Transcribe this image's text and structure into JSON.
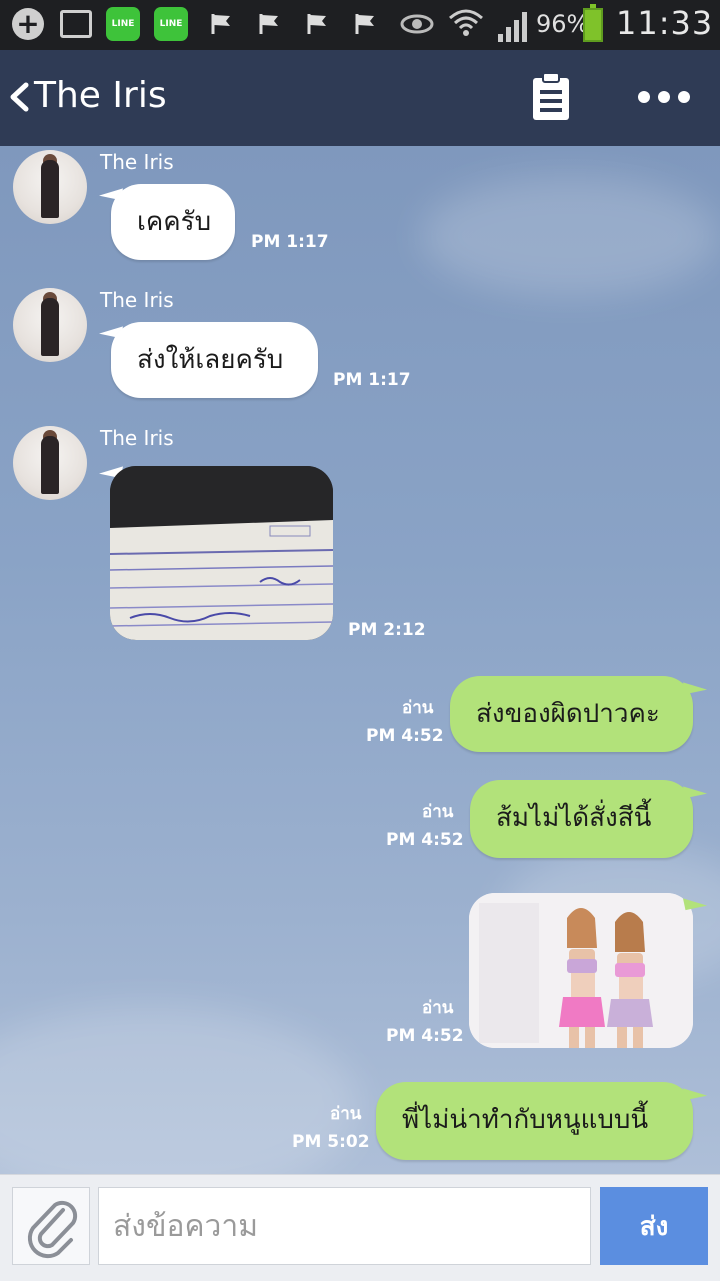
{
  "status_bar": {
    "battery_percent": "96%",
    "time": "11:33",
    "line_badge": "LINE",
    "icons": [
      "add-icon",
      "image-icon",
      "line-app-icon",
      "line-app-icon",
      "flag-icon",
      "flag-icon",
      "flag-icon",
      "flag-icon",
      "eye-icon",
      "wifi-icon",
      "signal-icon",
      "battery-icon"
    ]
  },
  "header": {
    "title": "The Iris"
  },
  "messages": [
    {
      "direction": "in",
      "sender": "The Iris",
      "text": "เคครับ",
      "time": "PM 1:17"
    },
    {
      "direction": "in",
      "sender": "The Iris",
      "text": "ส่งให้เลยครับ",
      "time": "PM 1:17"
    },
    {
      "direction": "in",
      "sender": "The Iris",
      "type": "photo",
      "photo_desc": "receipt",
      "time": "PM 2:12"
    },
    {
      "direction": "out",
      "read": "อ่าน",
      "text": "ส่งของผิดปาวคะ",
      "time": "PM 4:52"
    },
    {
      "direction": "out",
      "read": "อ่าน",
      "text": "ส้มไม่ได้สั่งสีนี้",
      "time": "PM 4:52"
    },
    {
      "direction": "out",
      "read": "อ่าน",
      "type": "photo",
      "photo_desc": "swimwear",
      "time": "PM 4:52"
    },
    {
      "direction": "out",
      "read": "อ่าน",
      "text": "พี่ไม่น่าทำกับหนูแบบนี้",
      "time": "PM 5:02"
    }
  ],
  "input_bar": {
    "placeholder": "ส่งข้อความ",
    "send_label": "ส่ง"
  },
  "colors": {
    "header_bg": "#2f3b55",
    "incoming_bubble": "#ffffff",
    "outgoing_bubble": "#b2e27a",
    "send_button": "#5b8ee0"
  }
}
